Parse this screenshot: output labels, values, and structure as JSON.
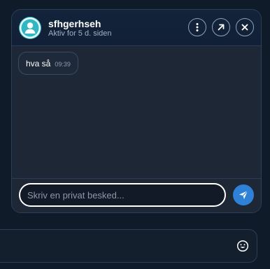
{
  "chat": {
    "contact_name": "sfhgerhseh",
    "status": "Aktiv for 5 d. siden",
    "header_icons": {
      "menu": "more-vertical-icon",
      "popout": "arrow-up-right-icon",
      "close": "close-icon"
    },
    "messages": [
      {
        "text": "hva så",
        "time": "09:39"
      }
    ],
    "composer": {
      "placeholder": "Skriv en privat besked...",
      "value": "",
      "send_icon": "send-icon"
    }
  },
  "bottom_bar": {
    "emoji_icon": "smiley-icon"
  },
  "colors": {
    "accent": "#2f80d7",
    "avatar": "#2fb8c4",
    "background": "#101b29"
  }
}
